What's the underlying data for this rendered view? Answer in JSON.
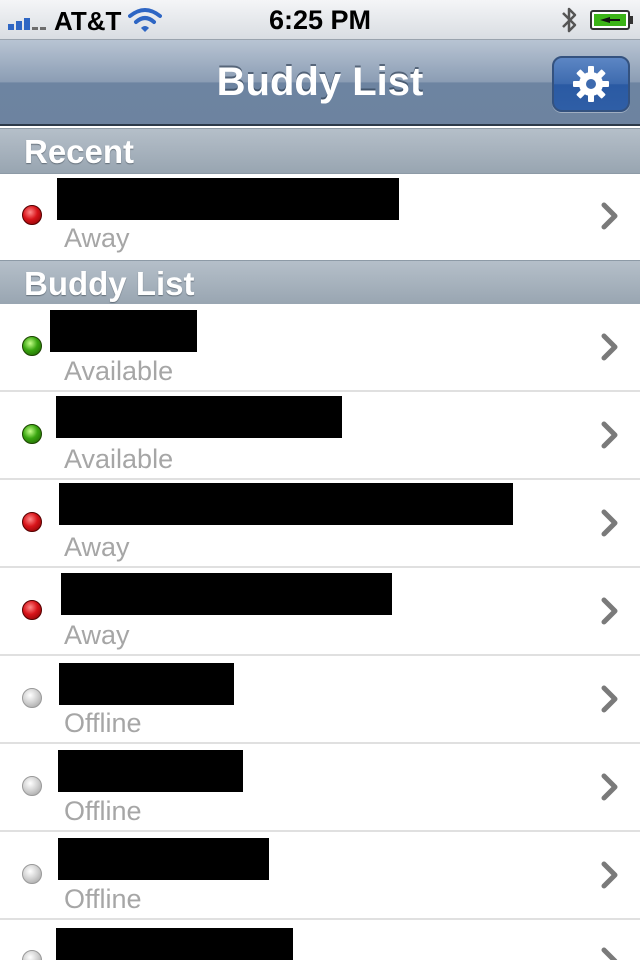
{
  "status_bar": {
    "carrier": "AT&T",
    "time": "6:25 PM"
  },
  "nav": {
    "title": "Buddy List",
    "settings_icon": "gear-icon"
  },
  "sections": [
    {
      "title": "Recent",
      "rows": [
        {
          "status": "Away",
          "presence": "away"
        }
      ]
    },
    {
      "title": "Buddy List",
      "rows": [
        {
          "status": "Available",
          "presence": "available"
        },
        {
          "status": "Available",
          "presence": "available"
        },
        {
          "status": "Away",
          "presence": "away"
        },
        {
          "status": "Away",
          "presence": "away"
        },
        {
          "status": "Offline",
          "presence": "offline"
        },
        {
          "status": "Offline",
          "presence": "offline"
        },
        {
          "status": "Offline",
          "presence": "offline"
        },
        {
          "status": "",
          "presence": "offline"
        }
      ]
    }
  ],
  "colors": {
    "away": "#d8141a",
    "available": "#3aa610",
    "offline": "#bdbdbd",
    "nav_bar": "#6d84a1",
    "status_text": "#a6a6a6"
  }
}
